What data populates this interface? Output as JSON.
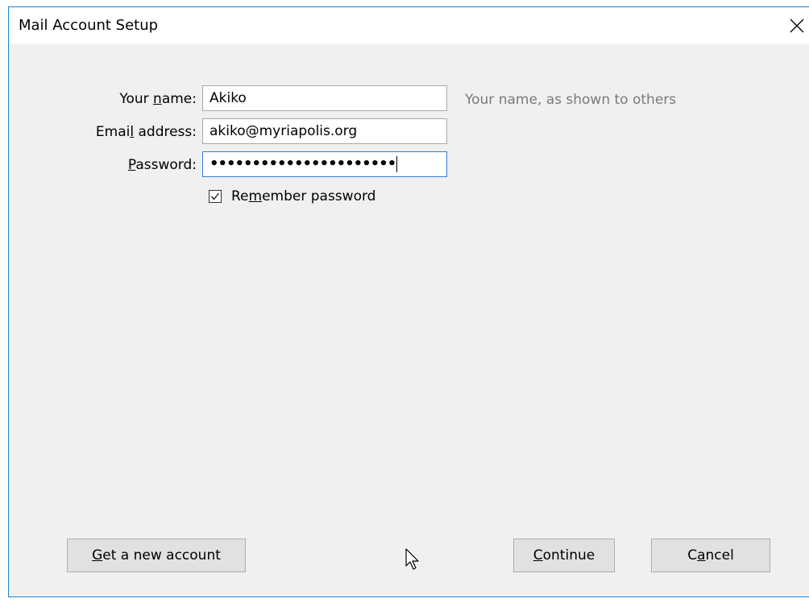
{
  "window": {
    "title": "Mail Account Setup",
    "close_icon": "close-icon"
  },
  "form": {
    "name": {
      "label_pre": "Your ",
      "label_mn": "n",
      "label_post": "ame:",
      "value": "Akiko",
      "hint": "Your name, as shown to others"
    },
    "email": {
      "label_pre": "Emai",
      "label_mn": "l",
      "label_post": " address:",
      "value": "akiko@myriapolis.org"
    },
    "password": {
      "label_pre": "",
      "label_mn": "P",
      "label_post": "assword:",
      "masked_value": "••••••••••••••••••••••"
    },
    "remember": {
      "checked": true,
      "label_pre": "Re",
      "label_mn": "m",
      "label_post": "ember password"
    }
  },
  "buttons": {
    "get_account": {
      "pre": "",
      "mn": "G",
      "post": "et a new account"
    },
    "continue": {
      "pre": "",
      "mn": "C",
      "post": "ontinue"
    },
    "cancel": {
      "pre": "C",
      "mn": "a",
      "post": "ncel"
    }
  },
  "colors": {
    "window_border": "#1883d7",
    "dialog_background": "#f0f0f0",
    "hint_text": "#7a7a7a",
    "focus_border": "#3a7bd5"
  }
}
